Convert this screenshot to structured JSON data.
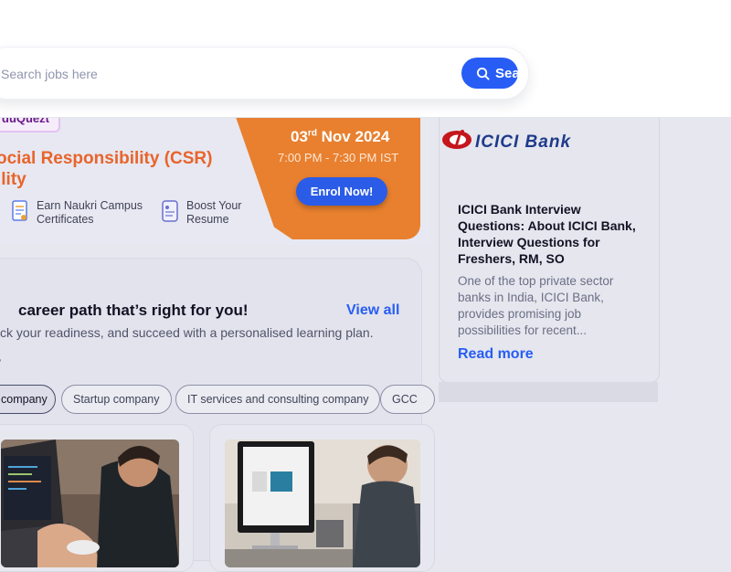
{
  "search": {
    "placeholder": "Search jobs here",
    "button_label": "Sea"
  },
  "banner": {
    "tag": "duQuezt",
    "title": "ocial Responsibility (CSR) ility",
    "features": [
      "Earn Naukri Campus\nCertificates",
      "Boost Your\nResume"
    ],
    "date_day": "03",
    "date_suffix": "rd",
    "date_rest": " Nov 2024",
    "time": "7:00 PM - 7:30 PM IST",
    "enrol_label": "Enrol Now!",
    "accent_color": "#e8802f"
  },
  "career": {
    "title": "career path that’s right for you!",
    "view_all": "View all",
    "subtitle": "ck your readiness, and succeed with a personalised learning plan.",
    "filter_label": "y",
    "chips": [
      "company",
      "Startup company",
      "IT services and consulting company",
      "GCC"
    ],
    "active_chip": "company"
  },
  "article": {
    "logo_text": "ICICI Bank",
    "title": "ICICI Bank Interview Questions: About ICICI Bank, Interview Questions for Freshers, RM, SO",
    "description": "One of the top private sector banks in India, ICICI Bank, provides promising job possibilities for recent...",
    "read_more": "Read more",
    "brand_color": "#c4161c"
  }
}
